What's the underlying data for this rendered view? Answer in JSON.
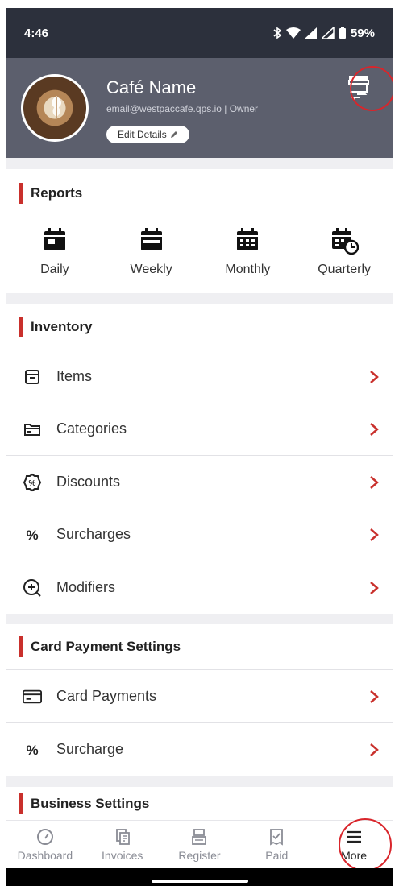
{
  "status_bar": {
    "time": "4:46",
    "battery": "59%"
  },
  "profile": {
    "name": "Café Name",
    "email": "email@westpaccafe.qps.io | Owner",
    "edit_label": "Edit Details"
  },
  "reports": {
    "title": "Reports",
    "items": [
      {
        "label": "Daily",
        "icon": "calendar-day-icon"
      },
      {
        "label": "Weekly",
        "icon": "calendar-week-icon"
      },
      {
        "label": "Monthly",
        "icon": "calendar-month-icon"
      },
      {
        "label": "Quarterly",
        "icon": "calendar-clock-icon"
      }
    ]
  },
  "inventory": {
    "title": "Inventory",
    "items": [
      {
        "label": "Items",
        "icon": "box-icon"
      },
      {
        "label": "Categories",
        "icon": "folder-icon"
      },
      {
        "label": "Discounts",
        "icon": "discount-badge-icon"
      },
      {
        "label": "Surcharges",
        "icon": "percent-icon"
      },
      {
        "label": "Modifiers",
        "icon": "plus-circle-icon"
      }
    ]
  },
  "card_payment": {
    "title": "Card Payment Settings",
    "items": [
      {
        "label": "Card Payments",
        "icon": "credit-card-icon"
      },
      {
        "label": "Surcharge",
        "icon": "percent-icon"
      }
    ]
  },
  "business": {
    "title": "Business Settings"
  },
  "bottom_nav": [
    {
      "label": "Dashboard",
      "icon": "gauge-icon",
      "active": false
    },
    {
      "label": "Invoices",
      "icon": "documents-icon",
      "active": false
    },
    {
      "label": "Register",
      "icon": "register-icon",
      "active": false
    },
    {
      "label": "Paid",
      "icon": "receipt-check-icon",
      "active": false
    },
    {
      "label": "More",
      "icon": "menu-icon",
      "active": true
    }
  ],
  "colors": {
    "accent": "#c9302c",
    "header": "#5c5f6d",
    "status_bar": "#2c303c",
    "highlight": "#d9252b"
  }
}
